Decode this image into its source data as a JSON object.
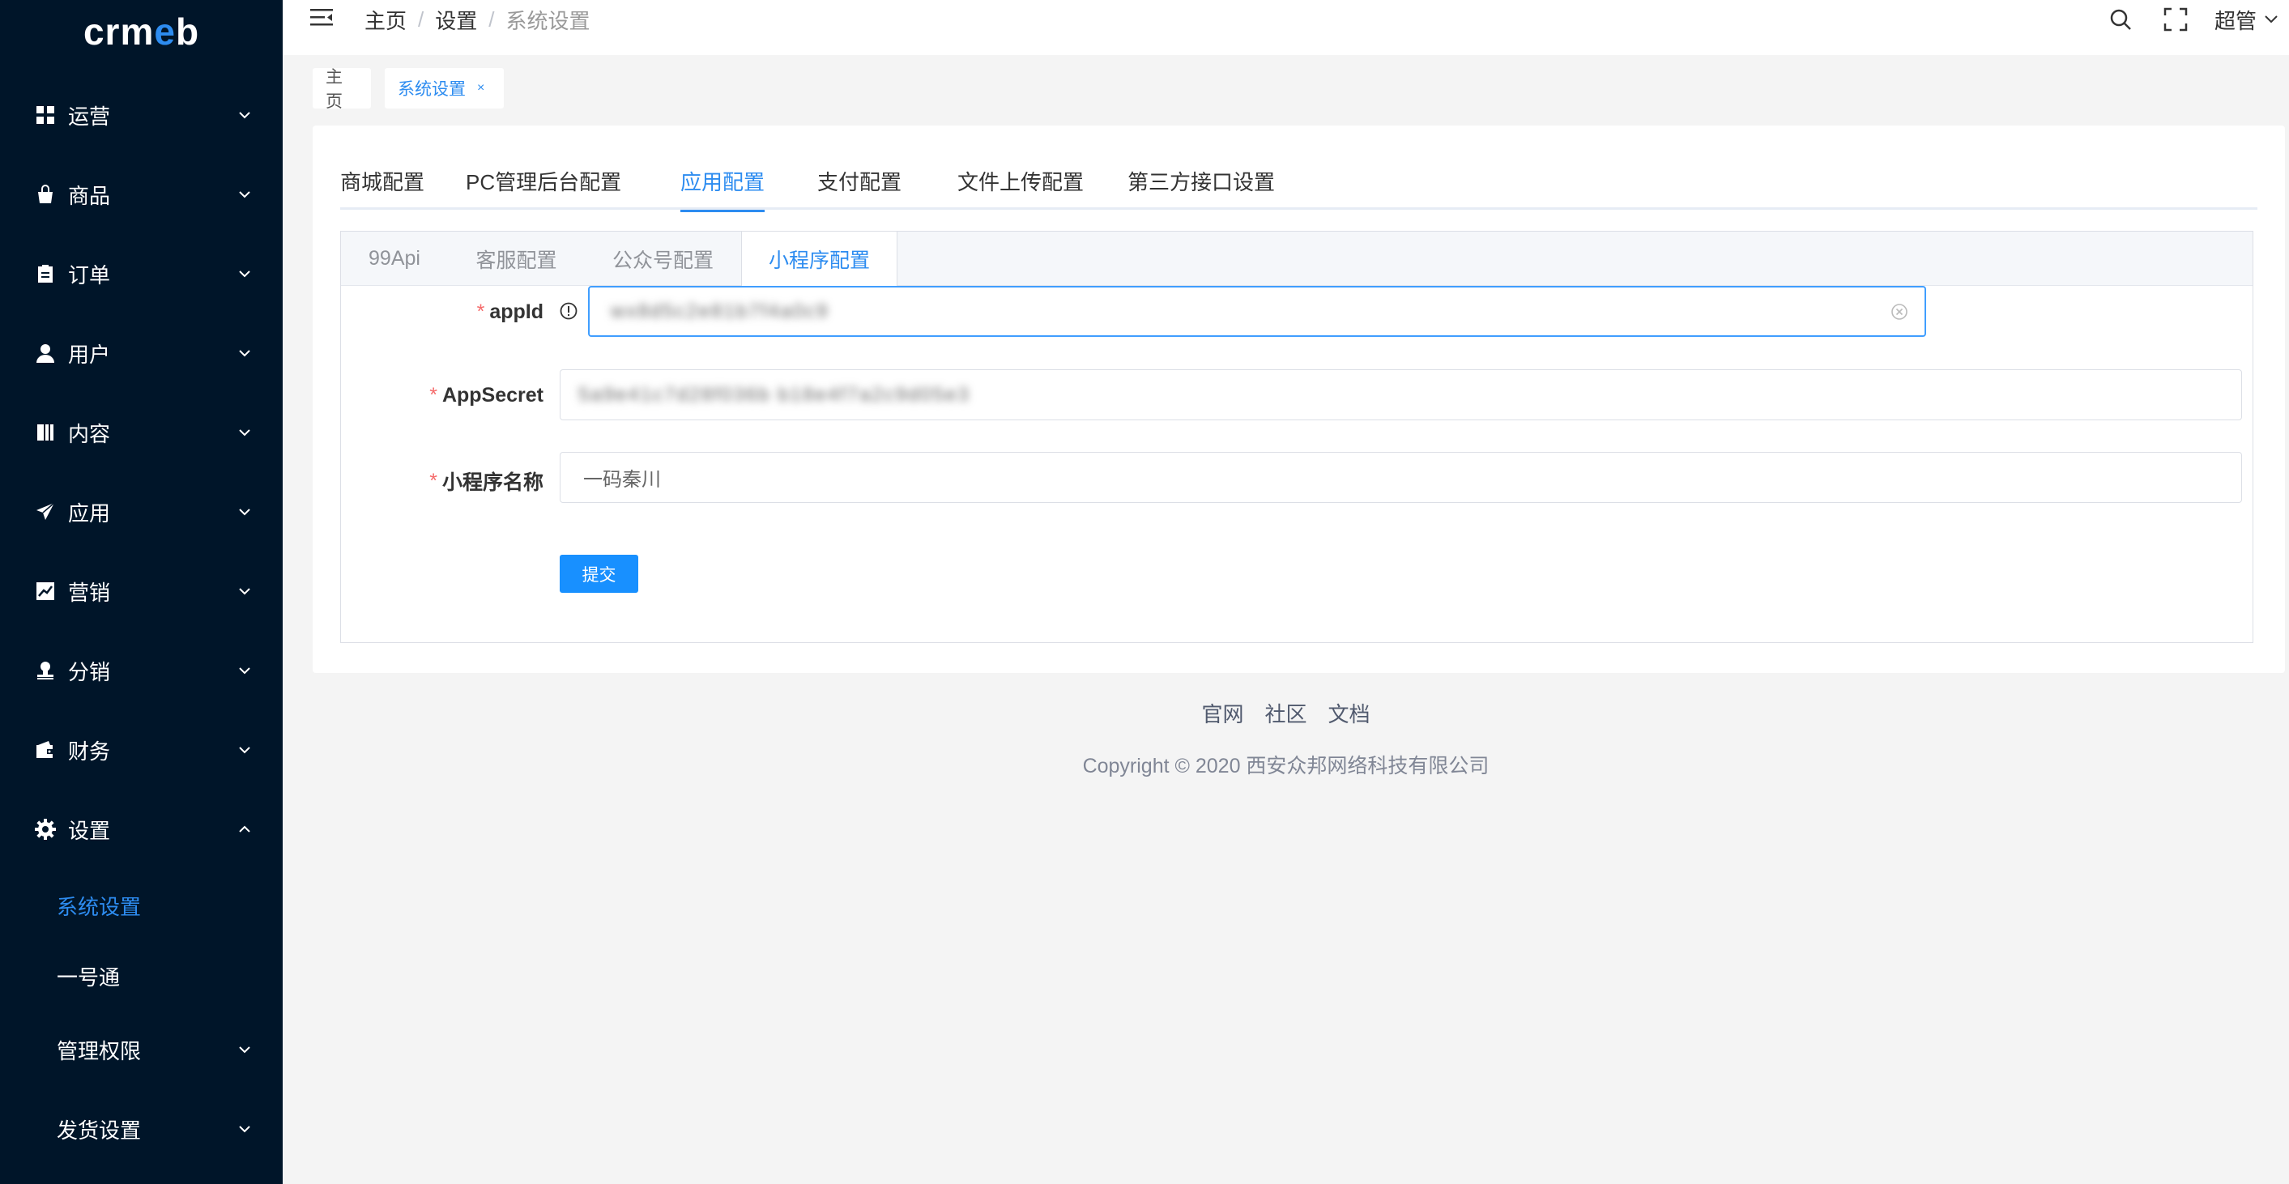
{
  "logo": {
    "text_left": "crm",
    "text_hl": "e",
    "text_right": "b"
  },
  "sidebar": {
    "items": [
      {
        "label": "运营",
        "icon": "grid-icon"
      },
      {
        "label": "商品",
        "icon": "bag-icon"
      },
      {
        "label": "订单",
        "icon": "clipboard-icon"
      },
      {
        "label": "用户",
        "icon": "user-icon"
      },
      {
        "label": "内容",
        "icon": "book-icon"
      },
      {
        "label": "应用",
        "icon": "send-icon"
      },
      {
        "label": "营销",
        "icon": "chart-icon"
      },
      {
        "label": "分销",
        "icon": "stamp-icon"
      },
      {
        "label": "财务",
        "icon": "wallet-icon"
      },
      {
        "label": "设置",
        "icon": "gear-icon"
      }
    ],
    "sub_items": [
      {
        "label": "系统设置",
        "active": true
      },
      {
        "label": "一号通",
        "active": false
      },
      {
        "label": "管理权限",
        "active": false
      },
      {
        "label": "发货设置",
        "active": false
      }
    ]
  },
  "header": {
    "breadcrumb": [
      "主页",
      "设置",
      "系统设置"
    ],
    "separator": "/",
    "user": "超管"
  },
  "tags": {
    "home": "主页",
    "active": "系统设置",
    "close": "×"
  },
  "top_tabs": [
    "商城配置",
    "PC管理后台配置",
    "应用配置",
    "支付配置",
    "文件上传配置",
    "第三方接口设置"
  ],
  "sub_tabs": [
    "99Api",
    "客服配置",
    "公众号配置",
    "小程序配置"
  ],
  "form": {
    "required_mark": "*",
    "appid_label": "appId",
    "appid_value": "wx8d5c2e81b7f4a0c9",
    "appsecret_label": "AppSecret",
    "appsecret_value": "5a9e41c7d28f036b b18e4f7a2c9d05e3",
    "name_label": "小程序名称",
    "name_value": "一码秦川",
    "submit": "提交"
  },
  "footer": {
    "links": [
      "官网",
      "社区",
      "文档"
    ],
    "copyright": "Copyright © 2020 西安众邦网络科技有限公司"
  },
  "colors": {
    "sidebar_bg": "#001529",
    "accent": "#2d8cf0",
    "button": "#1890ff",
    "required": "#f56c6c"
  }
}
